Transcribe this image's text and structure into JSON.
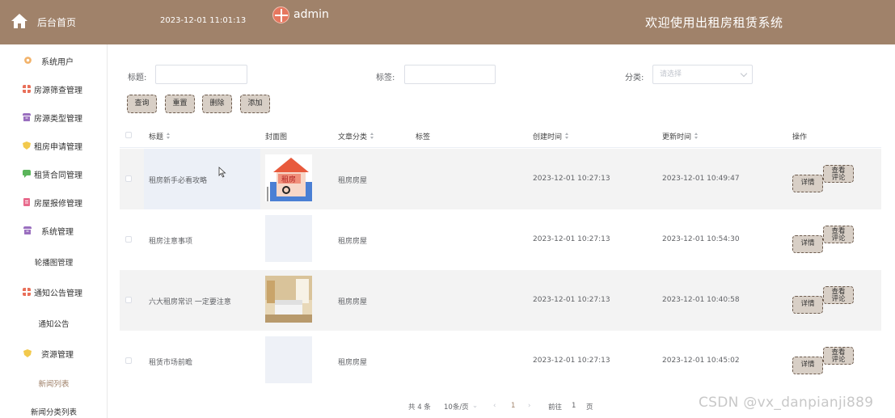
{
  "header": {
    "home_label": "后台首页",
    "datetime": "2023-12-01 11:01:13",
    "username": "admin",
    "system_title": "欢迎使用出租房租赁系统",
    "bg_color": "#a0826a"
  },
  "sidebar": {
    "items": [
      {
        "label": "系统用户",
        "icon": "gear-icon",
        "color": "#f2b36b"
      },
      {
        "label": "房源筛查管理",
        "icon": "grid-icon",
        "color": "#e8705a"
      },
      {
        "label": "房源类型管理",
        "icon": "archive-icon",
        "color": "#9a6fbf"
      },
      {
        "label": "租房申请管理",
        "icon": "shield-icon",
        "color": "#f2c94c"
      },
      {
        "label": "租赁合同管理",
        "icon": "chat-icon",
        "color": "#5ab55a"
      },
      {
        "label": "房屋报修管理",
        "icon": "document-icon",
        "color": "#e86a8c"
      },
      {
        "label": "系统管理",
        "icon": "archive-icon",
        "color": "#9a6fbf"
      },
      {
        "label": "通知公告管理",
        "icon": "grid-icon",
        "color": "#e8705a"
      },
      {
        "label": "资源管理",
        "icon": "shield-icon",
        "color": "#f2c94c"
      }
    ],
    "sub_carousel": "轮播图管理",
    "sub_notice": "通知公告",
    "sub_news": "新闻列表",
    "sub_news_category": "新闻分类列表"
  },
  "filters": {
    "title_label": "标题:",
    "tag_label": "标签:",
    "category_label": "分类:",
    "category_placeholder": "请选择"
  },
  "buttons": {
    "query": "查询",
    "reset": "重置",
    "delete": "删除",
    "add": "添加"
  },
  "table": {
    "headers": {
      "title": "标题",
      "cover": "封面图",
      "category": "文章分类",
      "tag": "标签",
      "created": "创建时间",
      "updated": "更新时间",
      "actions": "操作"
    },
    "rows": [
      {
        "title": "租房新手必看攻略",
        "category": "租房房屋",
        "tag": "",
        "created": "2023-12-01 10:27:13",
        "updated": "2023-12-01 10:49:47",
        "cover": "house-rent-image"
      },
      {
        "title": "租房注意事项",
        "category": "租房房屋",
        "tag": "",
        "created": "2023-12-01 10:27:13",
        "updated": "2023-12-01 10:54:30",
        "cover": "blank"
      },
      {
        "title": "六大租房常识 一定要注意",
        "category": "租房房屋",
        "tag": "",
        "created": "2023-12-01 10:27:13",
        "updated": "2023-12-01 10:40:58",
        "cover": "bedroom-image"
      },
      {
        "title": "租赁市场前瞻",
        "category": "租房房屋",
        "tag": "",
        "created": "2023-12-01 10:27:13",
        "updated": "2023-12-01 10:45:02",
        "cover": "blank"
      }
    ],
    "detail_label": "详情",
    "view_comments_label": "查看\n评论"
  },
  "pagination": {
    "total": "共 4 条",
    "page_size": "10条/页",
    "current_page": "1",
    "goto_label": "前往",
    "goto_value": "1",
    "page_unit": "页"
  },
  "watermark": "CSDN @vx_danpianji889",
  "sign_text": "租房"
}
